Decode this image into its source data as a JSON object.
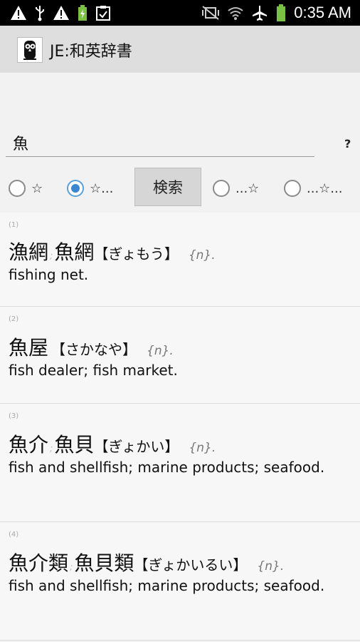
{
  "status_bar": {
    "time": "0:35 AM",
    "left_icons": [
      "warning-icon",
      "usb-icon",
      "warning-icon",
      "battery-charging-icon",
      "clipboard-icon"
    ],
    "right_icons": [
      "mute-vibrate-icon",
      "wifi-icon",
      "airplane-mode-icon",
      "battery-icon"
    ]
  },
  "app_bar": {
    "title": "JE:和英辞書",
    "icon": "owl-app-icon"
  },
  "search": {
    "value": "魚",
    "help_label": "?"
  },
  "match_options": [
    {
      "label": "☆",
      "selected": false
    },
    {
      "label": "☆...",
      "selected": true
    },
    {
      "label": "...☆",
      "selected": false
    },
    {
      "label": "...☆...",
      "selected": false
    }
  ],
  "search_button_label": "検索",
  "colors": {
    "radio_accent": "#3b87cf",
    "app_bar": "#dedede",
    "status_bar": "#000000"
  },
  "results": [
    {
      "num": "(1)",
      "k1": "漁網",
      "sep": ";",
      "k2": "魚網",
      "reading": "【ぎょもう】",
      "pos": "{n}.",
      "gloss": "fishing net."
    },
    {
      "num": "(2)",
      "k1": "魚屋",
      "sep": "",
      "k2": "",
      "reading": "【さかなや】",
      "pos": "{n}.",
      "gloss": "fish dealer; fish market."
    },
    {
      "num": "(3)",
      "k1": "魚介",
      "sep": ";",
      "k2": "魚貝",
      "reading": "【ぎょかい】",
      "pos": "{n}.",
      "gloss": "fish and shellfish; marine products; seafood."
    },
    {
      "num": "(4)",
      "k1": "魚介類",
      "sep": ";",
      "k2": "魚貝類",
      "reading": "【ぎょかいるい】",
      "pos": "{n}.",
      "gloss": "fish and shellfish; marine products; seafood."
    }
  ]
}
